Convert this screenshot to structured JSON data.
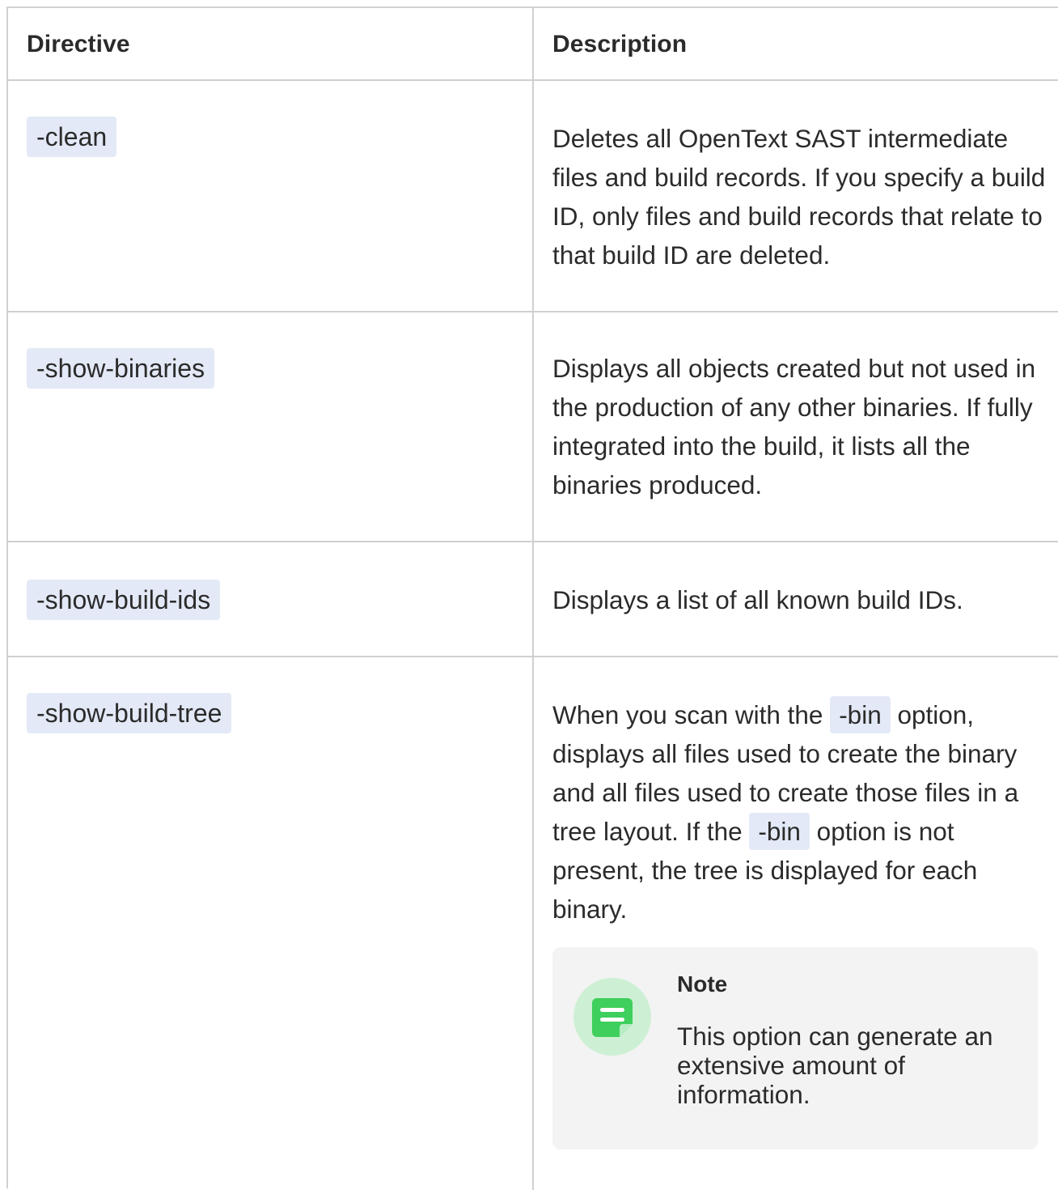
{
  "table": {
    "headers": {
      "directive": "Directive",
      "description": "Description"
    },
    "rows": [
      {
        "directive": "-clean",
        "description": "Deletes all OpenText SAST intermediate files and build records. If you specify a build ID, only files and build records that relate to that build ID are deleted."
      },
      {
        "directive": "-show-binaries",
        "description": "Displays all objects created but not used in the production of any other binaries. If fully integrated into the build, it lists all the binaries produced."
      },
      {
        "directive": "-show-build-ids",
        "description": "Displays a list of all known build IDs."
      },
      {
        "directive": "-show-build-tree",
        "description_parts": [
          "When you scan with the ",
          "-bin",
          " option, displays all files used to create the binary and all files used to create those files in a tree layout. If the ",
          "-bin",
          " option is not present, the tree is displayed for each binary."
        ],
        "note": {
          "title": "Note",
          "text": "This option can generate an extensive amount of information.",
          "icon": "note-icon"
        }
      }
    ]
  },
  "colors": {
    "code_background": "#e3e9f6",
    "note_background": "#f3f3f3",
    "note_icon_green": "#3ecf5c",
    "note_icon_circle": "#cdf0d4",
    "border": "#d0d0d0"
  }
}
